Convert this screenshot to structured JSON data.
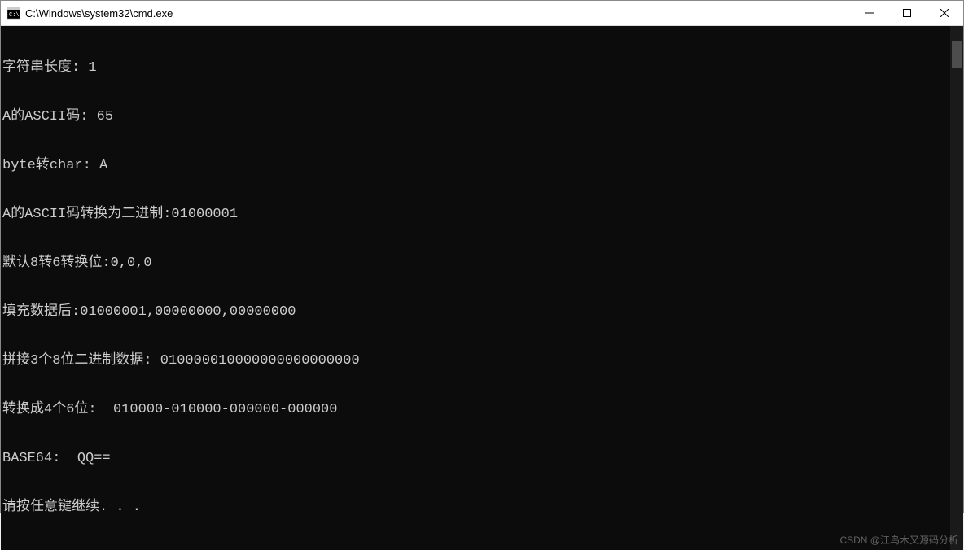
{
  "window": {
    "title": "C:\\Windows\\system32\\cmd.exe"
  },
  "console": {
    "lines": [
      "字符串长度: 1",
      "A的ASCII码: 65",
      "byte转char: A",
      "A的ASCII码转换为二进制:01000001",
      "默认8转6转换位:0,0,0",
      "填充数据后:01000001,00000000,00000000",
      "拼接3个8位二进制数据: 010000010000000000000000",
      "转换成4个6位:  010000-010000-000000-000000",
      "BASE64:  QQ==",
      "请按任意键继续. . ."
    ]
  },
  "watermark": "CSDN @江鸟木又源码分析"
}
